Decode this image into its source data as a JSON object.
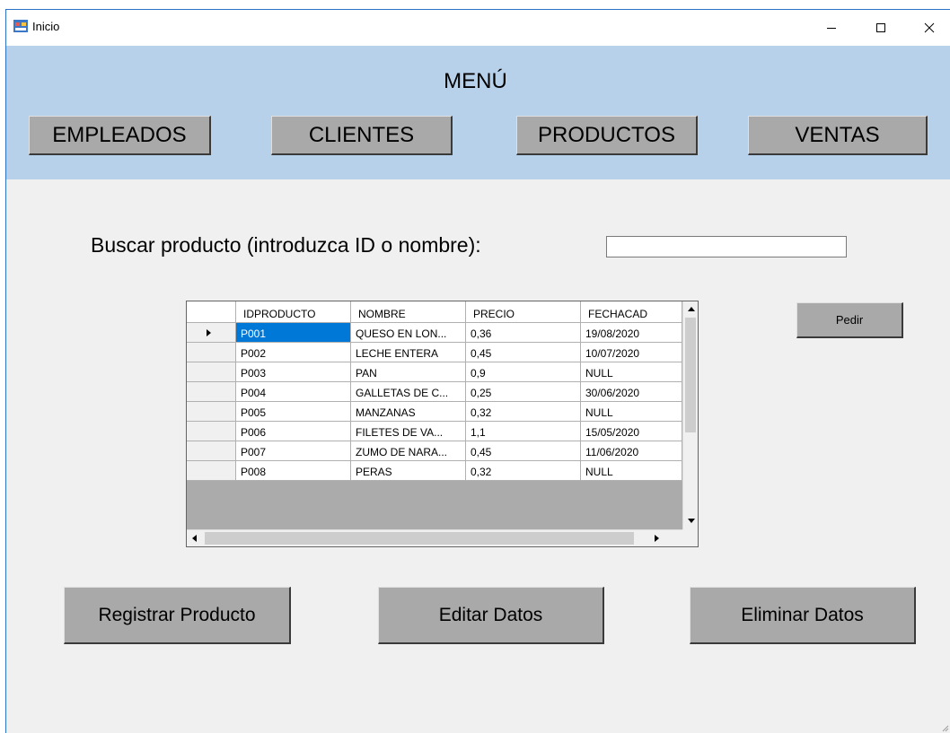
{
  "window": {
    "title": "Inicio",
    "app_icon": "windows-form-icon",
    "controls": [
      "minimize-icon",
      "maximize-icon",
      "close-icon"
    ]
  },
  "menu": {
    "title": "MENÚ",
    "buttons": [
      "EMPLEADOS",
      "CLIENTES",
      "PRODUCTOS",
      "VENTAS"
    ],
    "band_color": "#b8d1ea"
  },
  "search": {
    "label": "Buscar producto (introduzca ID o nombre):",
    "value": ""
  },
  "pedir_button": "Pedir",
  "grid": {
    "columns": [
      "IDPRODUCTO",
      "NOMBRE",
      "PRECIO",
      "FECHACAD"
    ],
    "rows": [
      [
        "P001",
        "QUESO EN LON...",
        "0,36",
        "19/08/2020"
      ],
      [
        "P002",
        "LECHE ENTERA",
        "0,45",
        "10/07/2020"
      ],
      [
        "P003",
        "PAN",
        "0,9",
        "NULL"
      ],
      [
        "P004",
        "GALLETAS DE C...",
        "0,25",
        "30/06/2020"
      ],
      [
        "P005",
        "MANZANAS",
        "0,32",
        "NULL"
      ],
      [
        "P006",
        "FILETES DE VA...",
        "1,1",
        "15/05/2020"
      ],
      [
        "P007",
        "ZUMO DE NARA...",
        "0,45",
        "11/06/2020"
      ],
      [
        "P008",
        "PERAS",
        "0,32",
        "NULL"
      ]
    ],
    "selected_row": 0,
    "selection_color": "#0078d7"
  },
  "actions": {
    "register": "Registrar Producto",
    "edit": "Editar Datos",
    "delete": "Eliminar Datos"
  },
  "button_color": "#a9a9a9"
}
